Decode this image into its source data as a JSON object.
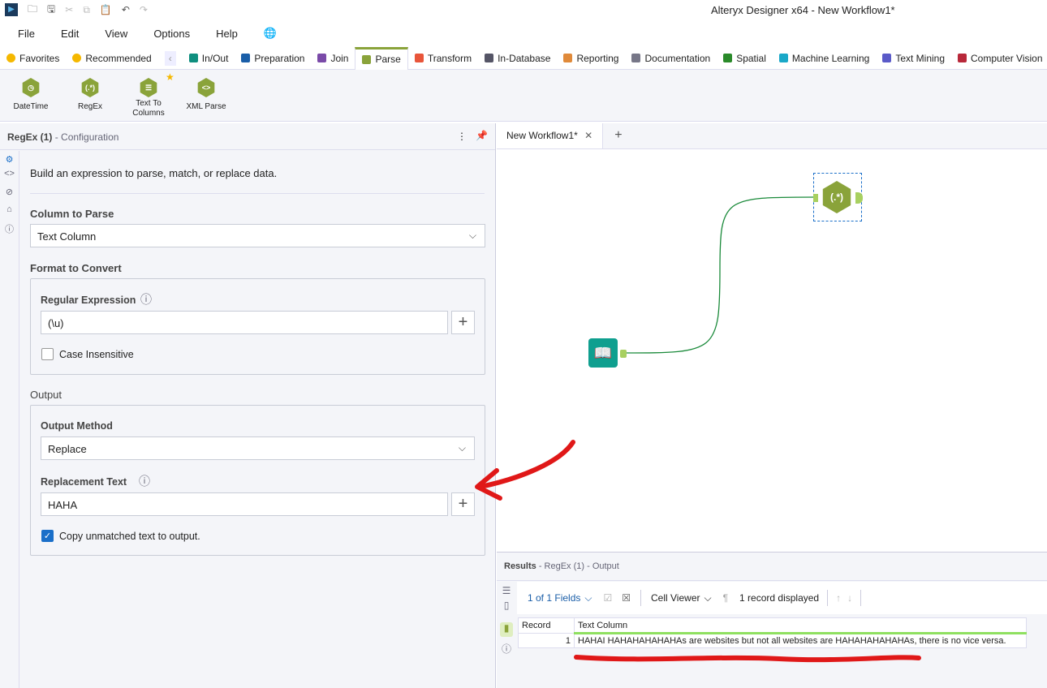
{
  "window": {
    "title": "Alteryx Designer x64 - New Workflow1*"
  },
  "menu": [
    "File",
    "Edit",
    "View",
    "Options",
    "Help"
  ],
  "palette_tabs": [
    {
      "label": "Favorites",
      "color": "#f5b800"
    },
    {
      "label": "Recommended",
      "color": "#f5b800"
    },
    {
      "label": "In/Out",
      "color": "#0f8f7f"
    },
    {
      "label": "Preparation",
      "color": "#1a5ea8"
    },
    {
      "label": "Join",
      "color": "#7a4aa8"
    },
    {
      "label": "Parse",
      "color": "#8aa33a"
    },
    {
      "label": "Transform",
      "color": "#e8553a"
    },
    {
      "label": "In-Database",
      "color": "#556"
    },
    {
      "label": "Reporting",
      "color": "#e08a3a"
    },
    {
      "label": "Documentation",
      "color": "#778"
    },
    {
      "label": "Spatial",
      "color": "#2a8a2a"
    },
    {
      "label": "Machine Learning",
      "color": "#1aa8c8"
    },
    {
      "label": "Text Mining",
      "color": "#5a5ac8"
    },
    {
      "label": "Computer Vision",
      "color": "#b8283a"
    }
  ],
  "tools": [
    {
      "label": "DateTime",
      "glyph": "◷"
    },
    {
      "label": "RegEx",
      "glyph": "(.*)"
    },
    {
      "label": "Text To Columns",
      "glyph": "☰"
    },
    {
      "label": "XML Parse",
      "glyph": "<>"
    }
  ],
  "config": {
    "title": "RegEx (1)",
    "subtitle": "- Configuration",
    "description": "Build an expression to parse, match, or replace data.",
    "column_label": "Column to Parse",
    "column_value": "Text Column",
    "format_label": "Format to Convert",
    "regex_label": "Regular Expression",
    "regex_value": "(\\u)",
    "case_label": "Case Insensitive",
    "case_checked": false,
    "output_label": "Output",
    "method_label": "Output Method",
    "method_value": "Replace",
    "replacement_label": "Replacement Text",
    "replacement_value": "HAHA",
    "copy_label": "Copy unmatched text to output.",
    "copy_checked": true
  },
  "canvas": {
    "tab": "New Workflow1*"
  },
  "results": {
    "title": "Results",
    "subtitle": "- RegEx (1) - Output",
    "fields": "1 of 1 Fields",
    "viewer": "Cell Viewer",
    "count": "1 record displayed",
    "headers": [
      "Record",
      "Text Column"
    ],
    "rows": [
      [
        "1",
        "HAHAI HAHAHAHAHAHAs are websites but not all websites are HAHAHAHAHAHAs, there is no vice versa."
      ]
    ]
  }
}
